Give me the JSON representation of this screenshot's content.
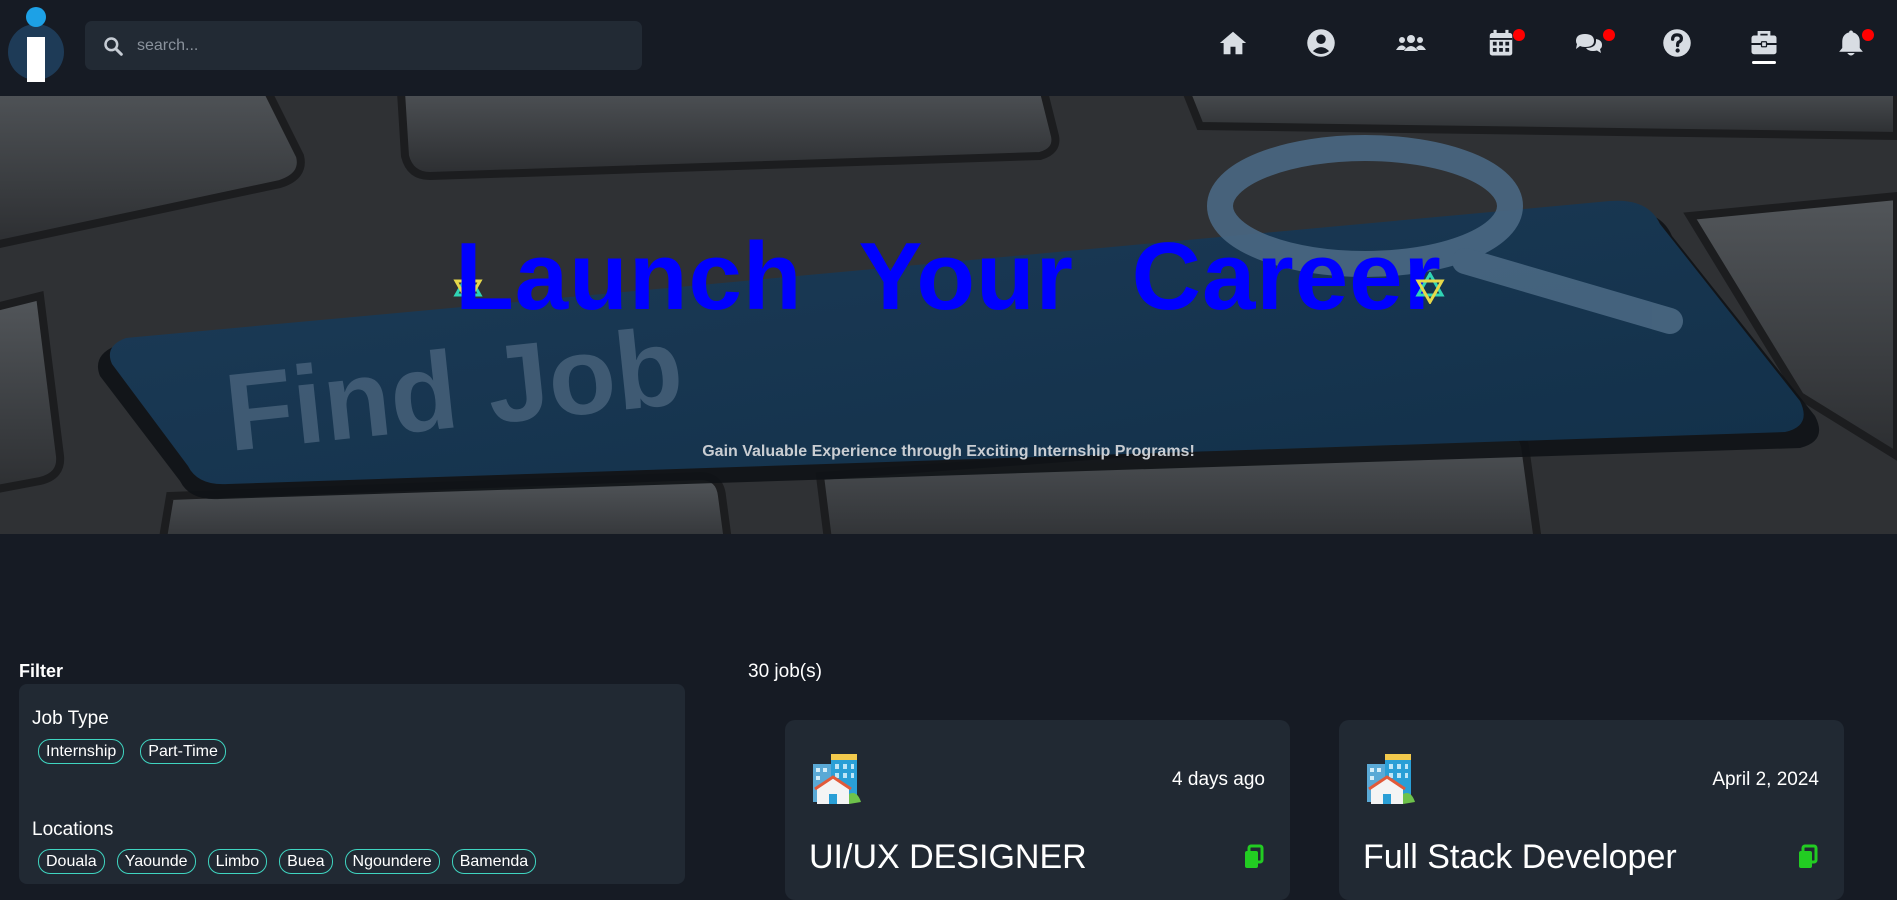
{
  "navbar": {
    "logo_text": "i",
    "search": {
      "placeholder": "search..."
    },
    "icons": [
      "home-icon",
      "profile-icon",
      "users-icon",
      "calendar-icon",
      "chat-icon",
      "help-icon",
      "briefcase-icon",
      "bell-icon"
    ],
    "active_item": "briefcase-icon"
  },
  "hero": {
    "title": "Launch Your Career",
    "subtitle": "Gain Valuable Experience through Exciting Internship Programs!",
    "key_text": "Find Job"
  },
  "filter": {
    "heading": "Filter",
    "job_type": {
      "label": "Job Type",
      "options": [
        "Internship",
        "Part-Time"
      ]
    },
    "locations": {
      "label": "Locations",
      "options": [
        "Douala",
        "Yaounde",
        "Limbo",
        "Buea",
        "Ngoundere",
        "Bamenda"
      ]
    }
  },
  "jobs": {
    "count": "30 job(s)",
    "cards": [
      {
        "posted": "4 days ago",
        "title": "UI/UX DESIGNER"
      },
      {
        "posted": "April 2, 2024",
        "title": "Full Stack Developer"
      }
    ]
  },
  "colors": {
    "background": "#161b24",
    "panel": "#212933",
    "hero_title": "#0000ff",
    "chip_border": "#3fd4c0",
    "notification_dot": "#ff0000",
    "apply_icon": "#22cc22"
  }
}
